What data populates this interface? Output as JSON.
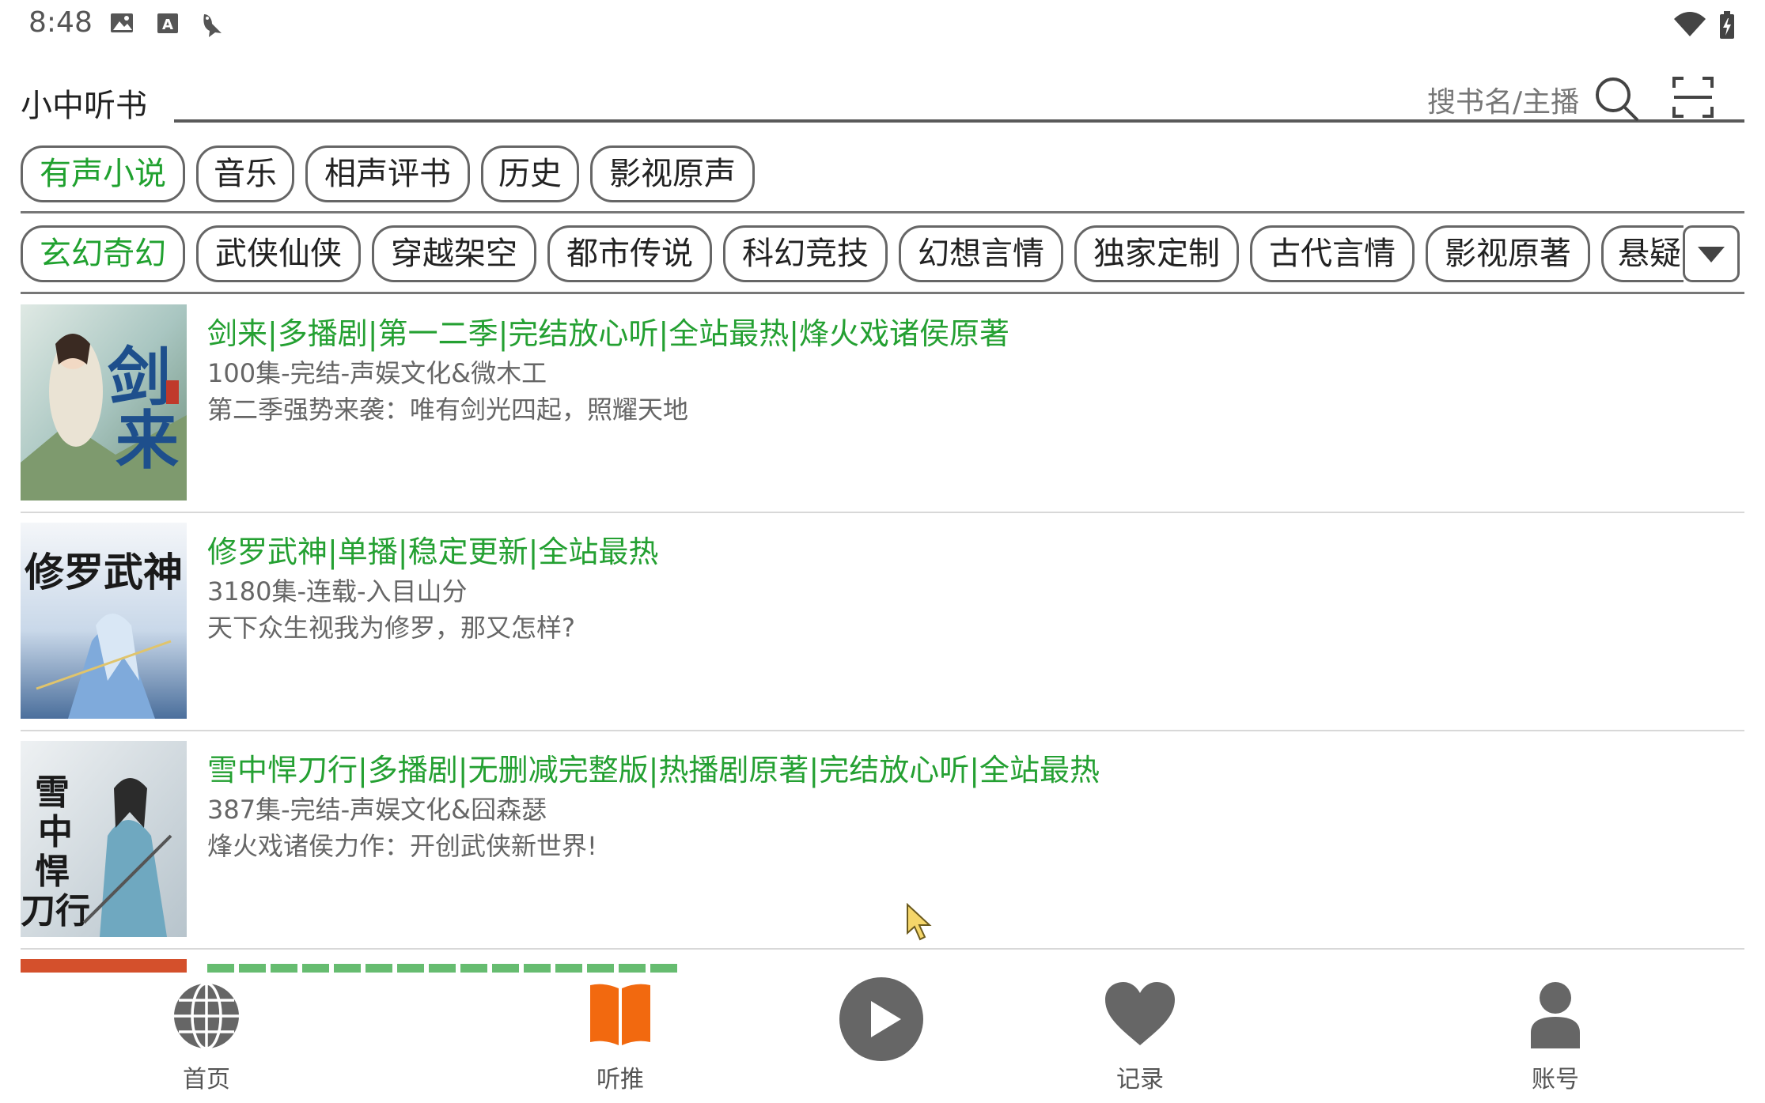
{
  "status_bar": {
    "time": "8:48",
    "icons": [
      "image-icon",
      "a-keyboard-icon",
      "bird-icon",
      "wifi-icon",
      "battery-icon"
    ]
  },
  "header": {
    "app_title": "小中听书",
    "search_placeholder": "搜书名/主播"
  },
  "categories": {
    "top": [
      {
        "label": "有声小说",
        "active": true
      },
      {
        "label": "音乐",
        "active": false
      },
      {
        "label": "相声评书",
        "active": false
      },
      {
        "label": "历史",
        "active": false
      },
      {
        "label": "影视原声",
        "active": false
      }
    ],
    "sub": [
      {
        "label": "玄幻奇幻",
        "active": true
      },
      {
        "label": "武侠仙侠",
        "active": false
      },
      {
        "label": "穿越架空",
        "active": false
      },
      {
        "label": "都市传说",
        "active": false
      },
      {
        "label": "科幻竞技",
        "active": false
      },
      {
        "label": "幻想言情",
        "active": false
      },
      {
        "label": "独家定制",
        "active": false
      },
      {
        "label": "古代言情",
        "active": false
      },
      {
        "label": "影视原著",
        "active": false
      },
      {
        "label": "悬疑",
        "active": false
      }
    ]
  },
  "books": [
    {
      "title": "剑来|多播剧|第一二季|完结放心听|全站最热|烽火戏诸侯原著",
      "meta": "100集-完结-声娱文化&微木工",
      "desc": "第二季强势来袭：唯有剑光四起，照耀天地"
    },
    {
      "title": "修罗武神|单播|稳定更新|全站最热",
      "meta": "3180集-连载-入目山分",
      "desc": "天下众生视我为修罗，那又怎样?"
    },
    {
      "title": "雪中悍刀行|多播剧|无删减完整版|热播剧原著|完结放心听|全站最热",
      "meta": "387集-完结-声娱文化&囧森瑟",
      "desc": "烽火戏诸侯力作：开创武侠新世界!"
    }
  ],
  "bottom_nav": [
    {
      "label": "首页",
      "icon": "globe-icon"
    },
    {
      "label": "听推",
      "icon": "open-book-icon"
    },
    {
      "label": "",
      "icon": "play-icon"
    },
    {
      "label": "记录",
      "icon": "heart-icon"
    },
    {
      "label": "账号",
      "icon": "person-icon"
    }
  ],
  "colors": {
    "accent_green": "#20a12f",
    "book_icon_orange": "#f2690f",
    "icon_gray": "#666666"
  }
}
